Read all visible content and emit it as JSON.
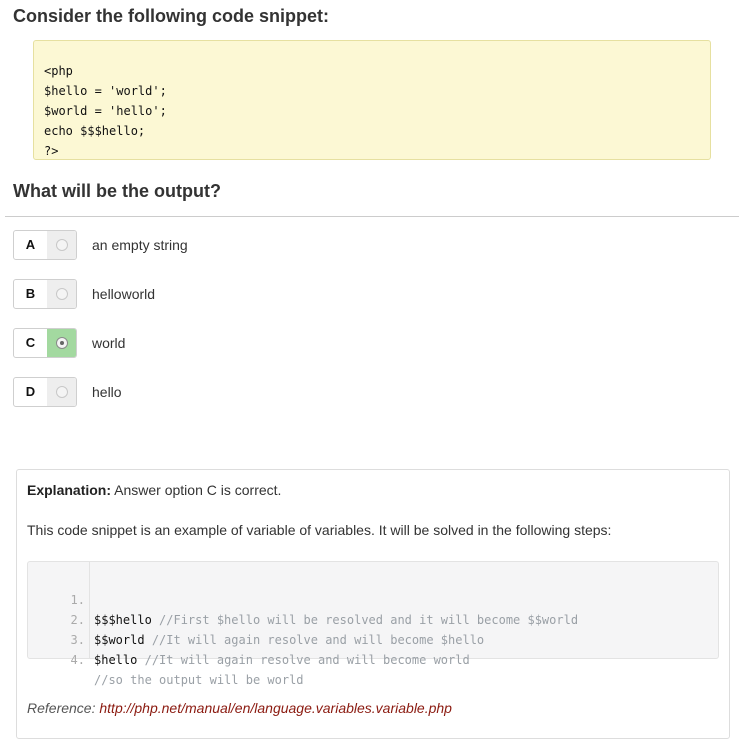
{
  "question": {
    "title": "Consider the following code snippet:",
    "code_lines": [
      "<php",
      "$hello = 'world';",
      "$world = 'hello';",
      "echo $$$hello;",
      "?>"
    ],
    "prompt": "What will be the output?"
  },
  "options": [
    {
      "letter": "A",
      "text": "an empty string",
      "selected": false
    },
    {
      "letter": "B",
      "text": "helloworld",
      "selected": false
    },
    {
      "letter": "C",
      "text": "world",
      "selected": true
    },
    {
      "letter": "D",
      "text": "hello",
      "selected": false
    }
  ],
  "explanation": {
    "label": "Explanation:",
    "summary": "Answer option C is correct.",
    "description": "This code snippet is an example of variable of variables. It will be solved in the following steps:",
    "steps": [
      {
        "num": "1.",
        "code": "$$$hello",
        "comment": "//First $hello will be resolved and it will become $$world"
      },
      {
        "num": "2.",
        "code": "$$world",
        "comment": "//It will again resolve and will become $hello"
      },
      {
        "num": "3.",
        "code": "$hello",
        "comment": "//It will again resolve and will become world"
      },
      {
        "num": "4.",
        "code": "",
        "comment": "//so the output will be world"
      }
    ],
    "reference_label": "Reference:",
    "reference_url": "http://php.net/manual/en/language.variables.variable.php"
  },
  "colors": {
    "code_bg": "#fcf8d4",
    "selected_radio_bg": "#a3d9a0",
    "link": "#8b1a10"
  }
}
